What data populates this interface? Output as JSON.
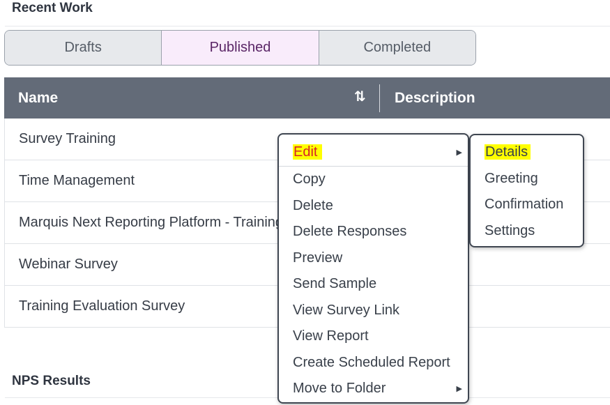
{
  "recent_work": {
    "title": "Recent Work"
  },
  "tabs": [
    {
      "label": "Drafts"
    },
    {
      "label": "Published"
    },
    {
      "label": "Completed"
    }
  ],
  "table": {
    "headers": {
      "name": "Name",
      "description": "Description"
    },
    "rows": [
      "Survey Training",
      "Time Management",
      "Marquis Next Reporting Platform - Training",
      "Webinar Survey",
      "Training Evaluation Survey"
    ]
  },
  "context_menu": {
    "items": [
      "Edit",
      "Copy",
      "Delete",
      "Delete Responses",
      "Preview",
      "Send Sample",
      "View Survey Link",
      "View Report",
      "Create Scheduled Report",
      "Move to Folder"
    ]
  },
  "edit_submenu": {
    "items": [
      "Details",
      "Greeting",
      "Confirmation",
      "Settings"
    ]
  },
  "nps": {
    "title": "NPS Results"
  },
  "colors": {
    "highlight": "#ffff00",
    "active_tab_bg": "#f9ecfb",
    "header_bg": "#636b78",
    "edit_text": "#d6202a"
  }
}
